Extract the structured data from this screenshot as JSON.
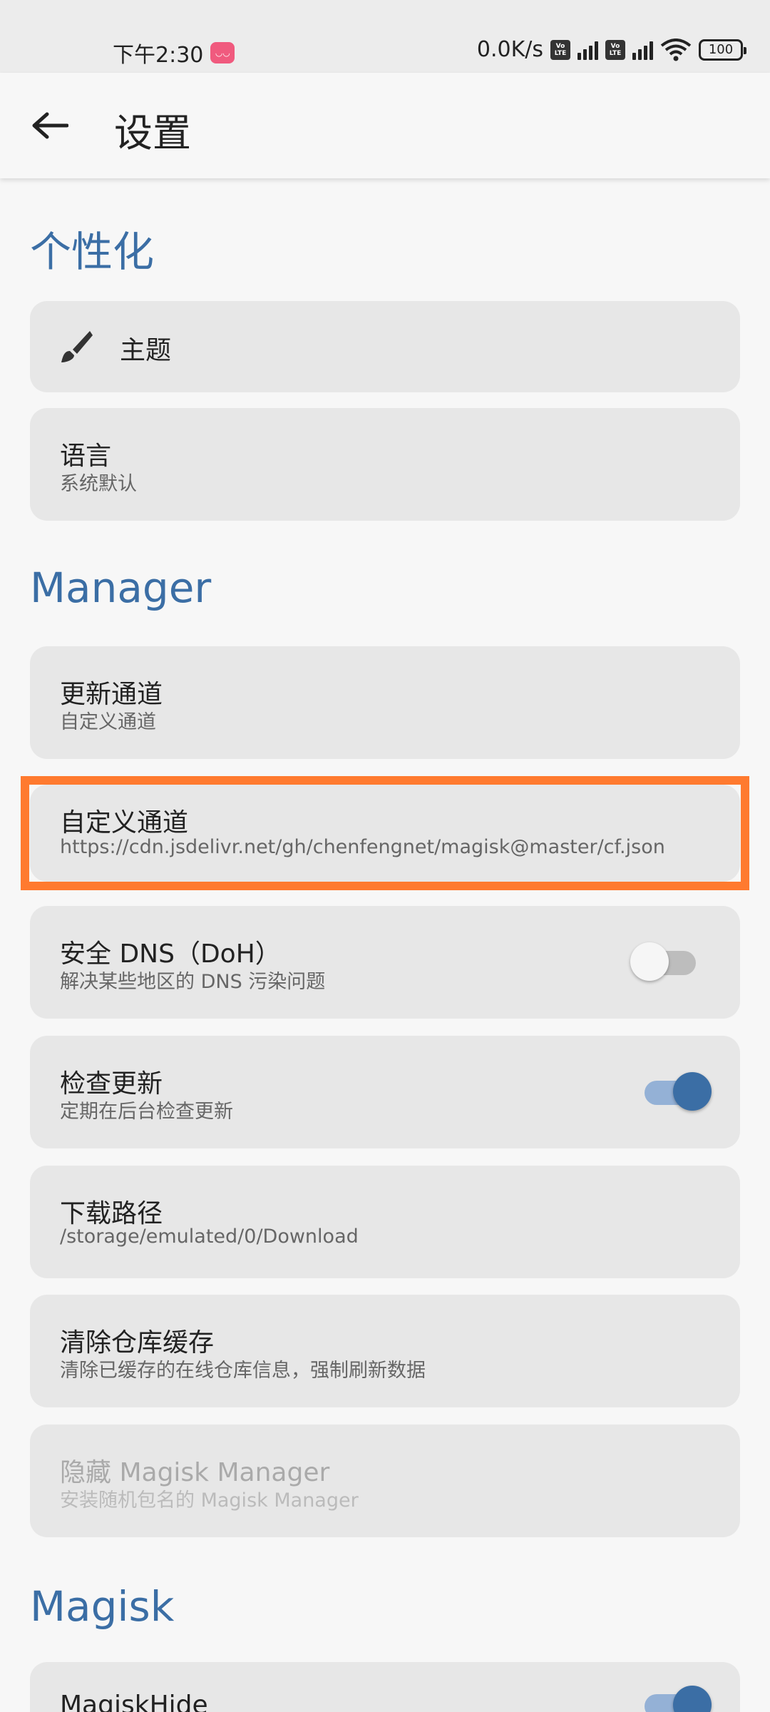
{
  "status_bar": {
    "time": "下午2:30",
    "net_speed": "0.0K/s",
    "volte_label_top": "Vo",
    "volte_label_bottom": "LTE",
    "battery": "100"
  },
  "app_bar": {
    "title": "设置",
    "back_icon": "arrow-left-icon"
  },
  "sections": {
    "personalize": {
      "title": "个性化",
      "theme": {
        "label": "主题",
        "icon": "brush-icon"
      },
      "language": {
        "label": "语言",
        "value": "系统默认"
      }
    },
    "manager": {
      "title": "Manager",
      "update_channel": {
        "label": "更新通道",
        "value": "自定义通道"
      },
      "custom_channel": {
        "label": "自定义通道",
        "value": "https://cdn.jsdelivr.net/gh/chenfengnet/magisk@master/cf.json"
      },
      "secure_dns": {
        "label": "安全 DNS（DoH）",
        "value": "解决某些地区的 DNS 污染问题",
        "enabled": false
      },
      "check_updates": {
        "label": "检查更新",
        "value": "定期在后台检查更新",
        "enabled": true
      },
      "download_path": {
        "label": "下载路径",
        "value": "/storage/emulated/0/Download"
      },
      "clear_cache": {
        "label": "清除仓库缓存",
        "value": "清除已缓存的在线仓库信息，强制刷新数据"
      },
      "hide_manager": {
        "label": "隐藏 Magisk Manager",
        "value": "安装随机包名的 Magisk Manager",
        "disabled": true
      }
    },
    "magisk": {
      "title": "Magisk",
      "magisk_hide": {
        "label": "MagiskHide",
        "enabled": true
      }
    }
  },
  "colors": {
    "accent": "#3b6ea5",
    "highlight": "#ff7a2f",
    "card": "#e7e7e7",
    "background": "#f7f7f7"
  }
}
